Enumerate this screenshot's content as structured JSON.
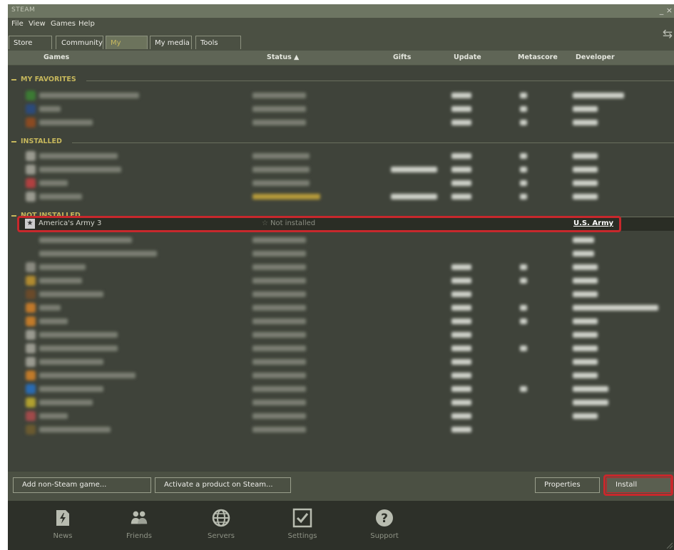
{
  "window": {
    "title": "STEAM",
    "controls": "_ ×"
  },
  "menu": [
    "File",
    "View",
    "Games",
    "Help"
  ],
  "tabs": [
    "Store",
    "Community",
    "My games",
    "My media",
    "Tools"
  ],
  "active_tab": "My games",
  "columns": {
    "games": "Games",
    "status": "Status ▲",
    "gifts": "Gifts",
    "update": "Update",
    "metascore": "Metascore",
    "developer": "Developer"
  },
  "groups": {
    "favorites": "MY FAVORITES",
    "installed": "INSTALLED",
    "not_installed": "NOT INSTALLED"
  },
  "selected_game": {
    "name": "America's Army 3",
    "status": "Not installed",
    "developer": "U.S. Army"
  },
  "buttons": {
    "add_non_steam": "Add non-Steam game...",
    "activate": "Activate a product on Steam...",
    "properties": "Properties",
    "install": "Install"
  },
  "dock": [
    {
      "label": "News",
      "icon": "news-icon"
    },
    {
      "label": "Friends",
      "icon": "friends-icon"
    },
    {
      "label": "Servers",
      "icon": "servers-icon"
    },
    {
      "label": "Settings",
      "icon": "settings-icon"
    },
    {
      "label": "Support",
      "icon": "support-icon"
    }
  ],
  "colors": {
    "highlight": "#c8282c",
    "group_label": "#c6b75c",
    "active_tab": "#c8b95f"
  }
}
